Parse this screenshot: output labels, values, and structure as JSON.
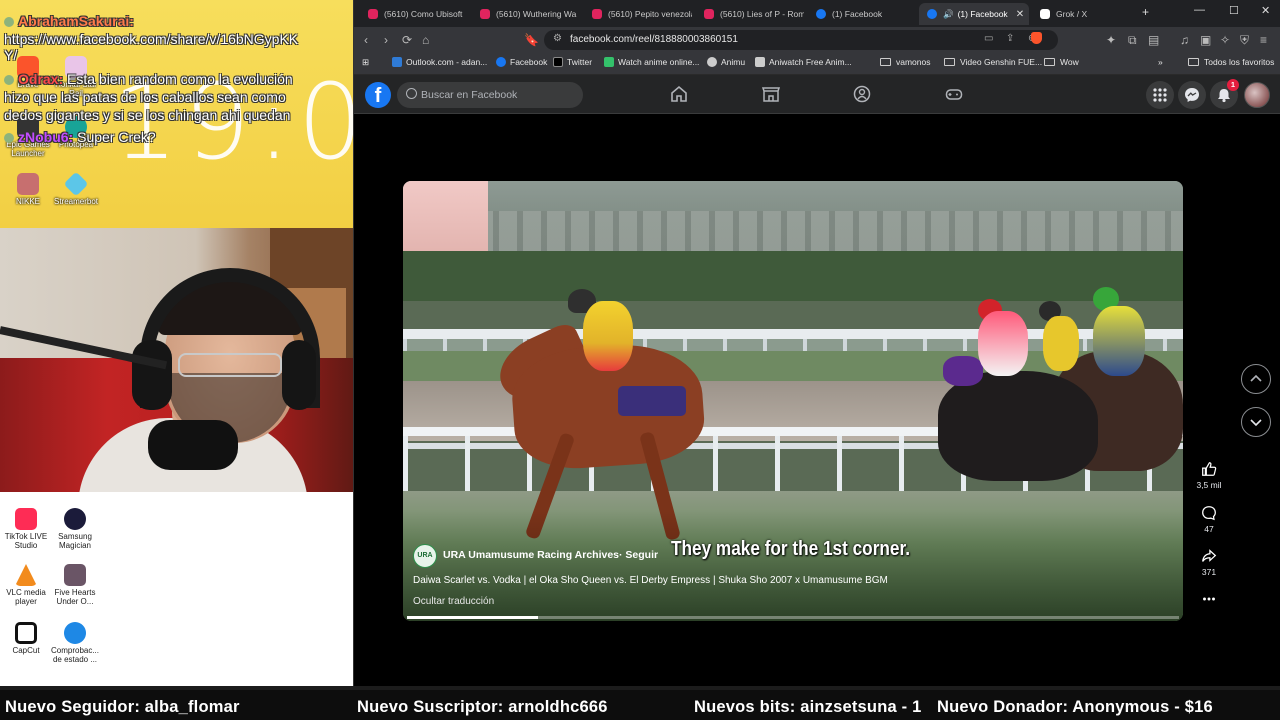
{
  "overlay": {
    "clock": "19:0",
    "chat": [
      {
        "user": "AbrahamSakurai:",
        "text": "",
        "color": "#ff7a4a"
      },
      {
        "user": "",
        "text": "https://www.facebook.com/share/v/16bNGypKK",
        "color": "#ffffff"
      },
      {
        "user": "",
        "text": "Y/",
        "color": "#ffffff"
      },
      {
        "user": "Odrax:",
        "text": " Esta bien random como la evolución",
        "color": "#ff4a4a"
      },
      {
        "user": "",
        "text": "hizo que las patas de los caballos sean como",
        "color": "#ffffff"
      },
      {
        "user": "",
        "text": "dedos gigantes y si se los chingan ahi quedan",
        "color": "#ffffff"
      },
      {
        "user": "zNobu6:",
        "text": " Super Crek?",
        "color": "#c34cff"
      }
    ],
    "desktop_icons_top": [
      {
        "label": "Brave",
        "color": "#fb542b"
      },
      {
        "label": "Honkai Star Rail",
        "color": "#e9c5e8"
      },
      {
        "label": "Epic Games Launcher",
        "color": "#333333"
      },
      {
        "label": "Photopea",
        "color": "#18a497"
      },
      {
        "label": "NIKKE",
        "color": "#c76f6f"
      },
      {
        "label": "Streamerbot",
        "color": "#5cc6e8"
      }
    ],
    "desktop_icons_bottom": [
      {
        "label": "TikTok LIVE Studio",
        "color": "#fe2c55"
      },
      {
        "label": "Samsung Magician",
        "color": "#1b1b3a"
      },
      {
        "label": "VLC media player",
        "color": "#f28b1d"
      },
      {
        "label": "Five Hearts Under O...",
        "color": "#6a5566"
      },
      {
        "label": "CapCut",
        "color": "#111111"
      },
      {
        "label": "Comprobac... de estado ...",
        "color": "#1e88e5"
      }
    ],
    "ticker": [
      "Nuevo Seguidor: alba_flomar",
      "Nuevo Suscriptor: arnoldhc666",
      "Nuevos bits: ainzsetsuna - 1",
      "Nuevo Donador: Anonymous - $16"
    ]
  },
  "browser": {
    "tabs": [
      {
        "title": "(5610) Como Ubisoft",
        "icon": "youtube-icon",
        "active": false
      },
      {
        "title": "(5610) Wuthering Wa",
        "icon": "youtube-icon",
        "active": false
      },
      {
        "title": "(5610) Pepito venezola",
        "icon": "youtube-icon",
        "active": false
      },
      {
        "title": "(5610) Lies of P - Rom",
        "icon": "youtube-icon",
        "active": false
      },
      {
        "title": "(1) Facebook",
        "icon": "facebook-icon",
        "active": false
      },
      {
        "title": "(1) Facebook",
        "icon": "facebook-icon",
        "active": true
      },
      {
        "title": "Grok / X",
        "icon": "x-icon",
        "active": false
      }
    ],
    "url": "facebook.com/reel/818880003860151",
    "bookmarks": [
      {
        "label": "Outlook.com - adan...",
        "type": "site",
        "color": "#2f7bd6"
      },
      {
        "label": "Facebook",
        "type": "site",
        "color": "#1877f2"
      },
      {
        "label": "Twitter",
        "type": "site",
        "color": "#000000"
      },
      {
        "label": "Watch anime online...",
        "type": "site",
        "color": "#34c26b"
      },
      {
        "label": "Animu",
        "type": "site",
        "color": "#cccccc"
      },
      {
        "label": "Aniwatch Free Anim...",
        "type": "site",
        "color": "#cccccc"
      },
      {
        "label": "vamonos",
        "type": "folder"
      },
      {
        "label": "Video Genshin FUE...",
        "type": "folder"
      },
      {
        "label": "Wow",
        "type": "folder"
      }
    ],
    "all_bookmarks": "Todos los favoritos"
  },
  "facebook": {
    "search_placeholder": "Buscar en Facebook",
    "notifications_count": "1",
    "reel": {
      "subtitle": "They make for the 1st corner.",
      "channel_avatar_text": "URA",
      "channel": "URA Umamusume Racing Archives",
      "follow": "· Seguir",
      "title": "Daiwa Scarlet vs. Vodka | el Oka Sho Queen vs. El Derby Empress | Shuka Sho 2007 x Umamusume BGM",
      "hide_translation": "Ocultar traducción",
      "progress": 0.17,
      "likes": "3,5 mil",
      "comments": "47",
      "shares": "371"
    }
  }
}
